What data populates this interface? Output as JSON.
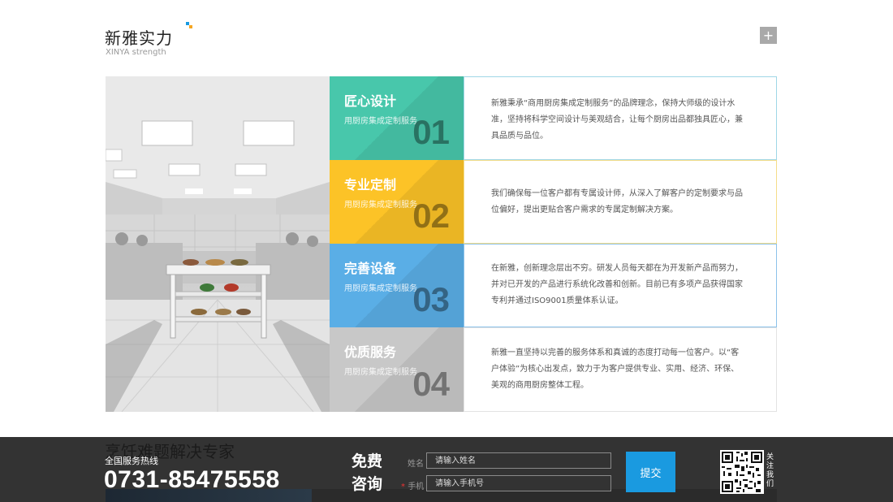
{
  "section": {
    "title": "新雅实力",
    "subtitle": "XINYA strength",
    "more_label": "+",
    "deco_colors": [
      "#1a9ae0",
      "#f5a623"
    ]
  },
  "features": [
    {
      "title": "匠心设计",
      "subtitle": "用厨房集成定制服务",
      "number": "01",
      "color": "#48c7ab",
      "description": "新雅秉承“商用厨房集成定制服务”的品牌理念，保持大师级的设计水准，坚持将科学空间设计与美观结合，让每个厨房出品都独具匠心，兼具品质与品位。",
      "border_color": "#9fd7e6"
    },
    {
      "title": "专业定制",
      "subtitle": "用厨房集成定制服务",
      "number": "02",
      "color": "#fcc327",
      "description": "我们确保每一位客户都有专属设计师，从深入了解客户的定制要求与品位偏好，提出更贴合客户需求的专属定制解决方案。",
      "border_color": "#f5dd8a"
    },
    {
      "title": "完善设备",
      "subtitle": "用厨房集成定制服务",
      "number": "03",
      "color": "#5aaee6",
      "description": "在新雅，创新理念层出不穷。研发人员每天都在为开发新产品而努力，并对已开发的产品进行系统化改善和创新。目前已有多项产品获得国家专利并通过ISO9001质量体系认证。",
      "border_color": "#8cc2ea"
    },
    {
      "title": "优质服务",
      "subtitle": "用厨房集成定制服务",
      "number": "04",
      "color": "#c8c8c8",
      "description": "新雅一直坚持以完善的服务体系和真诚的态度打动每一位客户。以“客户体验”为核心出发点，致力于为客户提供专业、实用、经济、环保、美观的商用厨房整体工程。",
      "border_color": "#e3e3e3"
    }
  ],
  "footer": {
    "next_section_title": "烹饪难题解决专家",
    "hotline_label": "全国服务热线",
    "hotline_number": "0731-85475558",
    "consult_label": "免费咨询",
    "name_label": "姓名",
    "name_placeholder": "请输入姓名",
    "phone_label": "手机",
    "phone_required_mark": "*",
    "phone_placeholder": "请输入手机号",
    "submit_label": "提交",
    "follow_label": "关注我们"
  }
}
